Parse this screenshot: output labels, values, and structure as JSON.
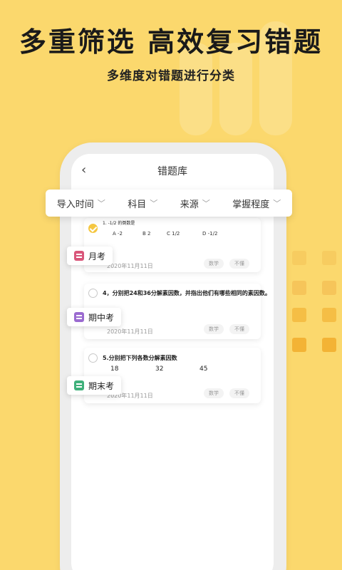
{
  "headline": "多重筛选  高效复习错题",
  "subline": "多维度对错题进行分类",
  "nav": {
    "back_icon": "‹",
    "title": "错题库"
  },
  "filters": [
    {
      "label": "导入时间"
    },
    {
      "label": "科目"
    },
    {
      "label": "来源"
    },
    {
      "label": "掌握程度"
    }
  ],
  "cards": [
    {
      "checked": true,
      "question": "1. -1/2 的倒数是",
      "options": [
        "A  -2",
        "B  2",
        "C  1/2",
        "D  -1/2"
      ],
      "date": "2020年11月11日",
      "subject": "数学",
      "mastery": "不懂"
    },
    {
      "checked": false,
      "question": "4，分别把24和36分解素因数，并指出他们有哪些相同的素因数。",
      "date": "2020年11月11日",
      "subject": "数学",
      "mastery": "不懂"
    },
    {
      "checked": false,
      "question": "5.分别把下列各数分解素因数",
      "numbers": [
        "18",
        "32",
        "45"
      ],
      "date": "2020年11月11日",
      "subject": "数学",
      "mastery": "不懂"
    }
  ],
  "exam_labels": [
    {
      "label": "月考",
      "color": "#D9567A"
    },
    {
      "label": "期中考",
      "color": "#9B6BD0"
    },
    {
      "label": "期末考",
      "color": "#3FB07A"
    }
  ],
  "colors": {
    "background": "#FBD86D",
    "accent": "#F5C741"
  }
}
